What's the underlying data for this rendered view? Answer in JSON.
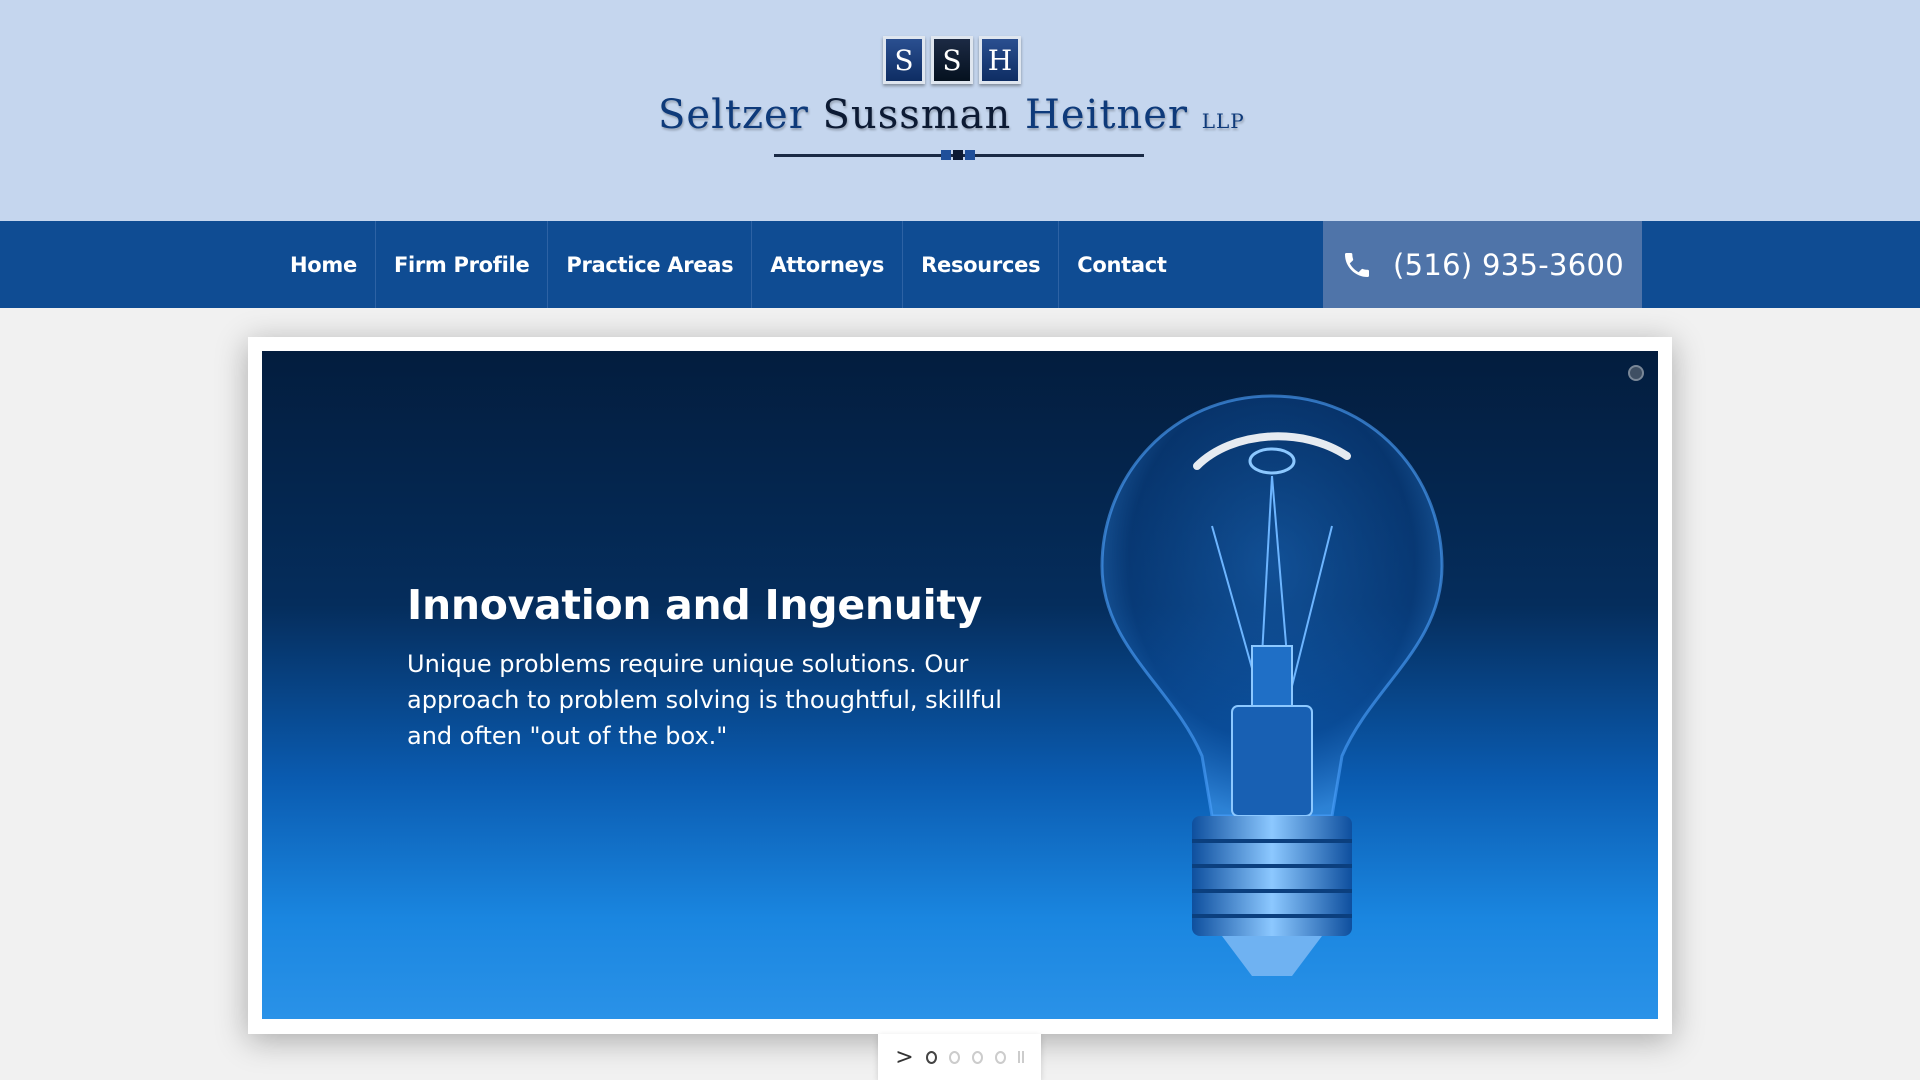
{
  "logo": {
    "letters": [
      "S",
      "S",
      "H"
    ],
    "name_part1": "Seltzer ",
    "name_part2": "Sussman ",
    "name_part3": "Heitner",
    "suffix": "LLP"
  },
  "nav": {
    "items": [
      {
        "label": "Home"
      },
      {
        "label": "Firm Profile"
      },
      {
        "label": "Practice Areas"
      },
      {
        "label": "Attorneys"
      },
      {
        "label": "Resources"
      },
      {
        "label": "Contact"
      }
    ]
  },
  "phone": {
    "number": "(516) 935-3600",
    "icon": "phone-icon"
  },
  "slide": {
    "title": "Innovation and Ingenuity",
    "body": "Unique problems require unique solutions. Our approach to problem solving is thoughtful, skillful and often \"out of the box.\""
  },
  "slider_controls": {
    "next_label": ">",
    "dot_count": 5,
    "active_index": 0
  },
  "colors": {
    "header_bg": "#c5d6ee",
    "nav_bg": "#0f4c93",
    "phone_bg": "#4f74a9",
    "brand_blue": "#0e3a7a"
  }
}
